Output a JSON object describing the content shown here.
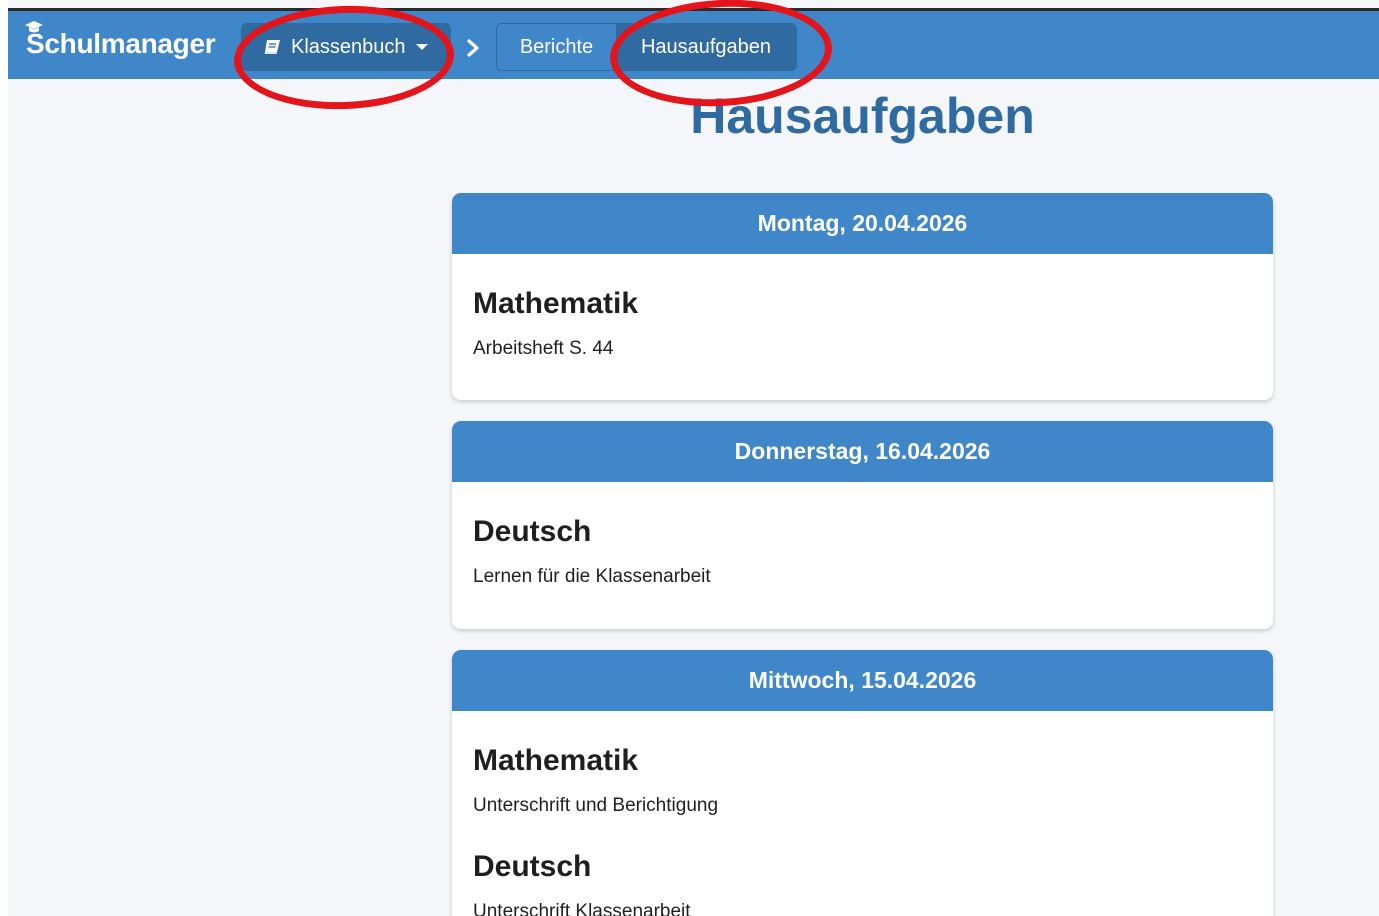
{
  "app": {
    "brand": "Schulmanager",
    "brand_icon": "graduation-cap-icon"
  },
  "nav": {
    "klassenbuch_label": "Klassenbuch",
    "klassenbuch_icon": "book-icon",
    "breadcrumb_separator_icon": "chevron-right-icon",
    "crumbs": [
      {
        "label": "Berichte"
      },
      {
        "label": "Hausaufgaben"
      }
    ]
  },
  "page": {
    "title": "Hausaufgaben"
  },
  "days": [
    {
      "date": "Montag, 20.04.2026",
      "entries": [
        {
          "subject": "Mathematik",
          "task": "Arbeitsheft S. 44"
        }
      ]
    },
    {
      "date": "Donnerstag, 16.04.2026",
      "entries": [
        {
          "subject": "Deutsch",
          "task": "Lernen für die Klassenarbeit"
        }
      ]
    },
    {
      "date": "Mittwoch, 15.04.2026",
      "entries": [
        {
          "subject": "Mathematik",
          "task": "Unterschrift und Berichtigung"
        },
        {
          "subject": "Deutsch",
          "task": "Unterschrift Klassenarbeit"
        }
      ]
    }
  ],
  "colors": {
    "navbar": "#3f87c8",
    "navbar_active": "#2f6aa0",
    "title": "#2f6aa0",
    "annotation": "#e4141b"
  }
}
